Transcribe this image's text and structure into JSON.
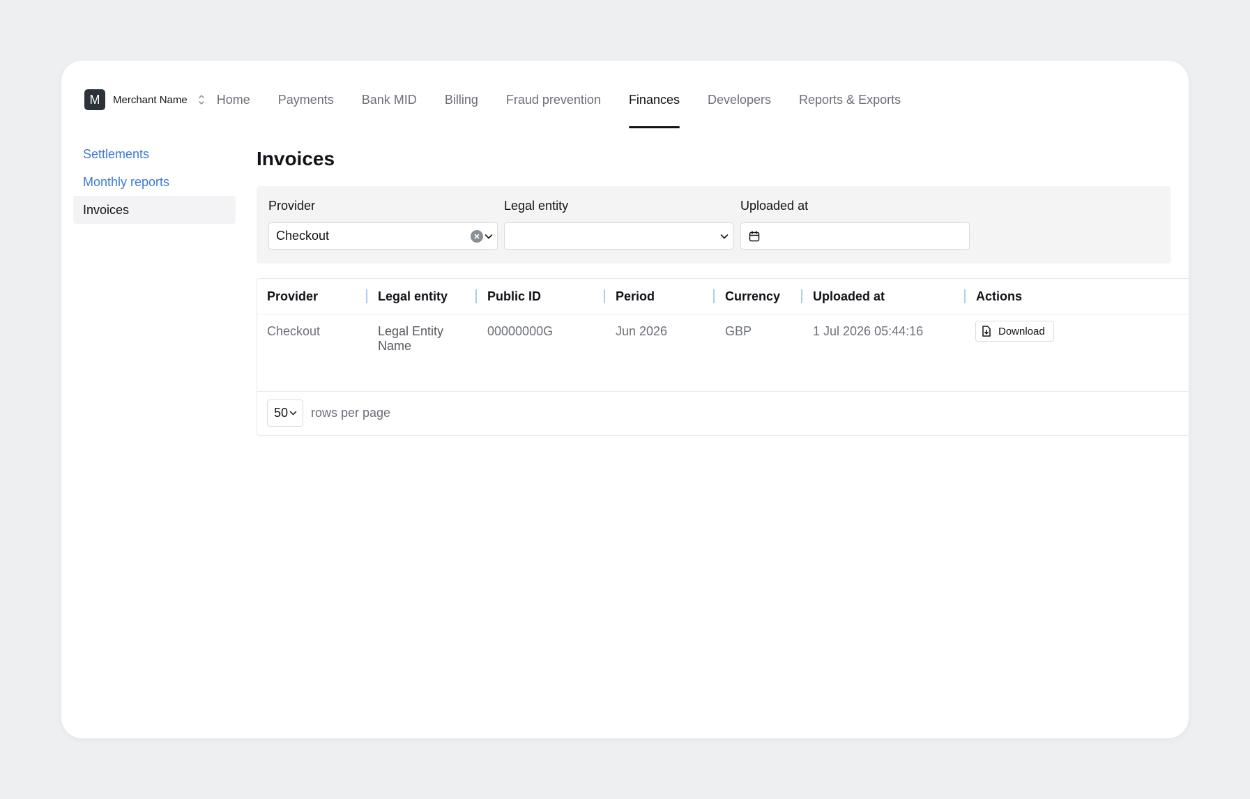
{
  "merchant": {
    "initial": "M",
    "name": "Merchant Name"
  },
  "nav": {
    "items": [
      {
        "label": "Home"
      },
      {
        "label": "Payments"
      },
      {
        "label": "Bank MID"
      },
      {
        "label": "Billing"
      },
      {
        "label": "Fraud prevention"
      },
      {
        "label": "Finances",
        "active": true
      },
      {
        "label": "Developers"
      },
      {
        "label": "Reports & Exports"
      }
    ]
  },
  "sidebar": {
    "items": [
      {
        "label": "Settlements"
      },
      {
        "label": "Monthly reports"
      },
      {
        "label": "Invoices",
        "active": true
      }
    ]
  },
  "page": {
    "title": "Invoices"
  },
  "filters": {
    "provider": {
      "label": "Provider",
      "value": "Checkout"
    },
    "legal_entity": {
      "label": "Legal entity",
      "value": ""
    },
    "uploaded_at": {
      "label": "Uploaded at",
      "value": ""
    }
  },
  "table": {
    "columns": [
      "Provider",
      "Legal entity",
      "Public ID",
      "Period",
      "Currency",
      "Uploaded at",
      "Actions"
    ],
    "rows": [
      {
        "provider": "Checkout",
        "legal_entity": "Legal Entity Name",
        "public_id": "00000000G",
        "period": "Jun 2026",
        "currency": "GBP",
        "uploaded_at": "1 Jul 2026 05:44:16",
        "action_label": "Download"
      }
    ]
  },
  "pagination": {
    "rows_per_page": "50",
    "rows_label": "rows per page"
  },
  "colors": {
    "link_blue": "#3b7bd1",
    "column_divider": "#a9cdee",
    "avatar_bg": "#2d313a",
    "page_bg": "#eeeff1"
  },
  "icons": {
    "merchant_switch": "chevron-up-down-icon",
    "clear": "clear-circle-icon",
    "select": "chevron-down-icon",
    "date": "calendar-icon",
    "download": "document-download-icon"
  }
}
